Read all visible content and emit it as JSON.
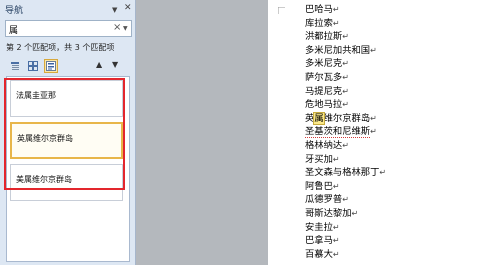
{
  "nav": {
    "title": "导航",
    "dropdown_glyph": "▼",
    "close_glyph": "✕",
    "search": {
      "value": "属",
      "clear_glyph": "×",
      "dropdown_glyph": "▼"
    },
    "match_info": "第 2 个匹配项，共 3 个匹配项",
    "tabs": [
      {
        "name": "headings",
        "icon": "headings-icon"
      },
      {
        "name": "pages",
        "icon": "thumbnails-icon"
      },
      {
        "name": "results",
        "icon": "search-results-icon",
        "selected": true
      }
    ],
    "prev_glyph": "▲",
    "next_glyph": "▼",
    "results": [
      {
        "text": "法属圭亚那"
      },
      {
        "text": "英属维尔京群岛",
        "selected": true
      },
      {
        "text": "美属维尔京群岛"
      }
    ],
    "highlight_color": "#e3262d"
  },
  "document": {
    "paragraph_mark": "↵",
    "lines": [
      {
        "text": "巴哈马"
      },
      {
        "text": "库拉索"
      },
      {
        "text": "洪都拉斯"
      },
      {
        "text": "多米尼加共和国"
      },
      {
        "text": "多米尼克"
      },
      {
        "text": "萨尔瓦多"
      },
      {
        "text": "马提尼克"
      },
      {
        "text": "危地马拉"
      },
      {
        "text": "英属维尔京群岛",
        "pre": "英",
        "match": "属",
        "post": "维尔京群岛"
      },
      {
        "text": "圣基茨和尼维斯"
      },
      {
        "text": "格林纳达"
      },
      {
        "text": "牙买加"
      },
      {
        "text": "圣文森与格林那丁"
      },
      {
        "text": "阿鲁巴"
      },
      {
        "text": "瓜德罗普"
      },
      {
        "text": "哥斯达黎加"
      },
      {
        "text": "安圭拉"
      },
      {
        "text": "巴拿马"
      },
      {
        "text": "百慕大"
      }
    ],
    "match_color": "#fbe98a"
  }
}
